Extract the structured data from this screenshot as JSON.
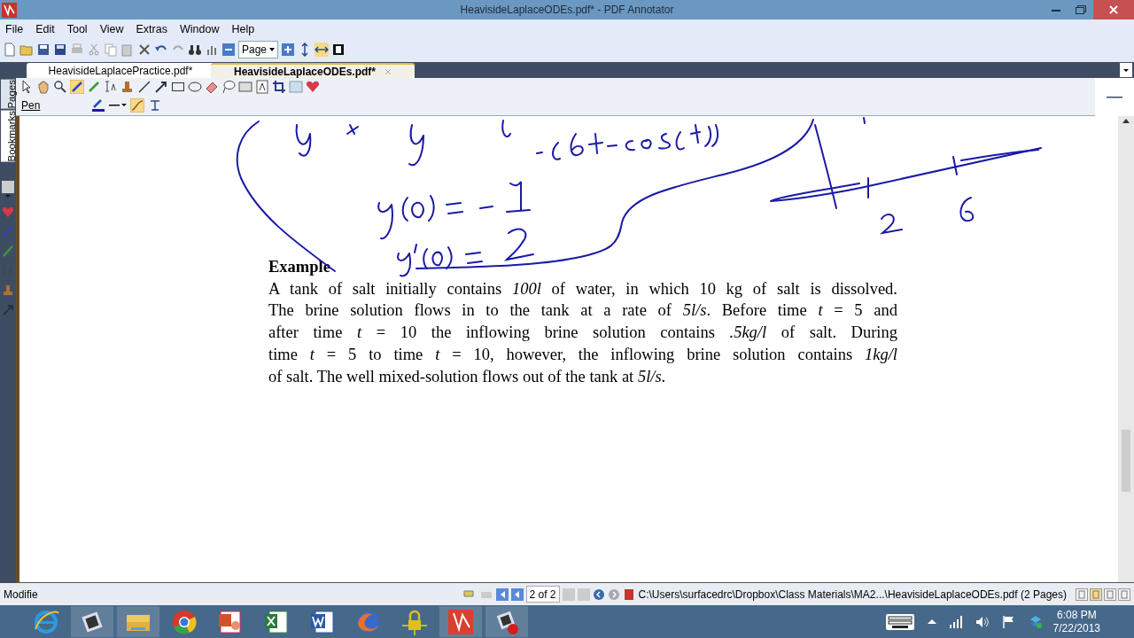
{
  "window": {
    "title": "HeavisideLaplaceODEs.pdf* - PDF Annotator"
  },
  "menu": [
    "File",
    "Edit",
    "Tool",
    "View",
    "Extras",
    "Window",
    "Help"
  ],
  "toolbar": {
    "zoom_mode": "Page"
  },
  "tabs": [
    {
      "label": "HeavisideLaplacePractice.pdf*",
      "selected": false
    },
    {
      "label": "HeavisideLaplaceODEs.pdf*",
      "selected": true
    }
  ],
  "side_tabs": [
    {
      "label": "Pages",
      "selected": false
    },
    {
      "label": "Bookmarks",
      "selected": true
    }
  ],
  "tool_label": "Pen",
  "document": {
    "heading": "Example",
    "lines": [
      "A tank of salt initially contains *100l* of water, in which 10 kg of salt is dissolved.",
      "The brine solution flows in to the tank at a rate of *5l/s*. Before time *t* = 5 and",
      "after time *t* = 10 the inflowing brine solution contains *.5kg/l* of salt. During",
      "time *t* = 5 to time *t* = 10, however, the inflowing brine solution contains *1kg/l*",
      "of salt. The well mixed-solution flows out of the tank at *5l/s*."
    ]
  },
  "status_bar": {
    "status": "Modifie",
    "page_field": "2 of 2",
    "path": "C:\\Users\\surfacedrc\\Dropbox\\Class Materials\\MA2...\\HeavisideLaplaceODEs.pdf (2 Pages)"
  },
  "taskbar": {
    "time": "6:08 PM",
    "date": "7/22/2013"
  }
}
